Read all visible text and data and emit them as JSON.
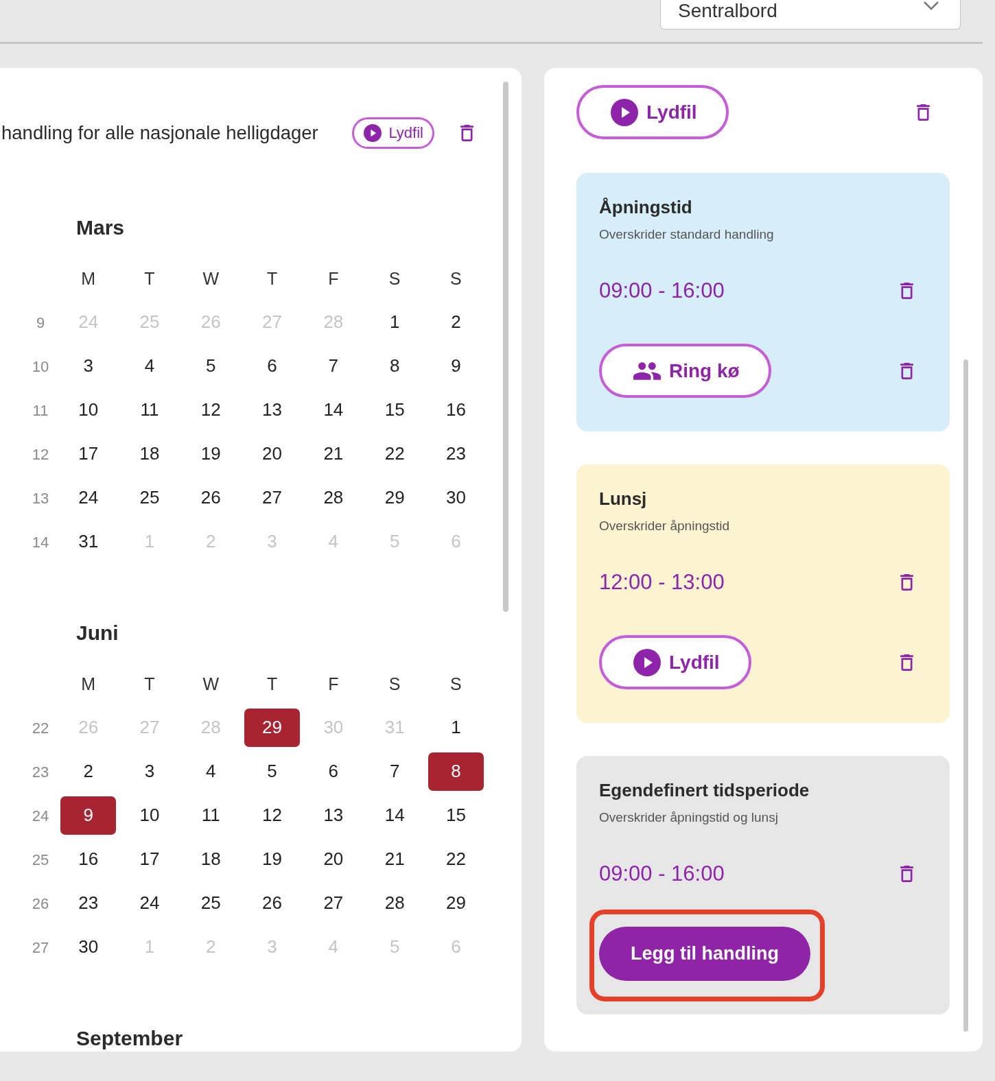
{
  "header": {
    "dropdown": {
      "value": "Sentralbord"
    }
  },
  "calendar_panel": {
    "title": "handling for alle nasjonale helligdager",
    "action": {
      "kind": "audio",
      "label": "Lydfil",
      "highlighted": false
    },
    "months": [
      {
        "name": "Mars",
        "weekday_labels": [
          "M",
          "T",
          "W",
          "T",
          "F",
          "S",
          "S"
        ],
        "weeks": [
          {
            "week": "9",
            "days": [
              {
                "day": "24",
                "kind": "outside"
              },
              {
                "day": "25",
                "kind": "outside"
              },
              {
                "day": "26",
                "kind": "outside"
              },
              {
                "day": "27",
                "kind": "outside"
              },
              {
                "day": "28",
                "kind": "outside"
              },
              {
                "day": "1",
                "kind": "current"
              },
              {
                "day": "2",
                "kind": "current"
              }
            ]
          },
          {
            "week": "10",
            "days": [
              {
                "day": "3",
                "kind": "current"
              },
              {
                "day": "4",
                "kind": "current"
              },
              {
                "day": "5",
                "kind": "current"
              },
              {
                "day": "6",
                "kind": "current"
              },
              {
                "day": "7",
                "kind": "current"
              },
              {
                "day": "8",
                "kind": "current"
              },
              {
                "day": "9",
                "kind": "current"
              }
            ]
          },
          {
            "week": "11",
            "days": [
              {
                "day": "10",
                "kind": "current"
              },
              {
                "day": "11",
                "kind": "current"
              },
              {
                "day": "12",
                "kind": "current"
              },
              {
                "day": "13",
                "kind": "current"
              },
              {
                "day": "14",
                "kind": "current"
              },
              {
                "day": "15",
                "kind": "current"
              },
              {
                "day": "16",
                "kind": "current"
              }
            ]
          },
          {
            "week": "12",
            "days": [
              {
                "day": "17",
                "kind": "current"
              },
              {
                "day": "18",
                "kind": "current"
              },
              {
                "day": "19",
                "kind": "current"
              },
              {
                "day": "20",
                "kind": "current"
              },
              {
                "day": "21",
                "kind": "current"
              },
              {
                "day": "22",
                "kind": "current"
              },
              {
                "day": "23",
                "kind": "current"
              }
            ]
          },
          {
            "week": "13",
            "days": [
              {
                "day": "24",
                "kind": "current"
              },
              {
                "day": "25",
                "kind": "current"
              },
              {
                "day": "26",
                "kind": "current"
              },
              {
                "day": "27",
                "kind": "current"
              },
              {
                "day": "28",
                "kind": "current"
              },
              {
                "day": "29",
                "kind": "current"
              },
              {
                "day": "30",
                "kind": "current"
              }
            ]
          },
          {
            "week": "14",
            "days": [
              {
                "day": "31",
                "kind": "current"
              },
              {
                "day": "1",
                "kind": "outside"
              },
              {
                "day": "2",
                "kind": "outside"
              },
              {
                "day": "3",
                "kind": "outside"
              },
              {
                "day": "4",
                "kind": "outside"
              },
              {
                "day": "5",
                "kind": "outside"
              },
              {
                "day": "6",
                "kind": "outside"
              }
            ]
          }
        ]
      },
      {
        "name": "Juni",
        "weekday_labels": [
          "M",
          "T",
          "W",
          "T",
          "F",
          "S",
          "S"
        ],
        "weeks": [
          {
            "week": "22",
            "days": [
              {
                "day": "26",
                "kind": "outside"
              },
              {
                "day": "27",
                "kind": "outside"
              },
              {
                "day": "28",
                "kind": "outside"
              },
              {
                "day": "29",
                "kind": "holiday"
              },
              {
                "day": "30",
                "kind": "outside"
              },
              {
                "day": "31",
                "kind": "outside"
              },
              {
                "day": "1",
                "kind": "current"
              }
            ]
          },
          {
            "week": "23",
            "days": [
              {
                "day": "2",
                "kind": "current"
              },
              {
                "day": "3",
                "kind": "current"
              },
              {
                "day": "4",
                "kind": "current"
              },
              {
                "day": "5",
                "kind": "current"
              },
              {
                "day": "6",
                "kind": "current"
              },
              {
                "day": "7",
                "kind": "current"
              },
              {
                "day": "8",
                "kind": "holiday"
              }
            ]
          },
          {
            "week": "24",
            "days": [
              {
                "day": "9",
                "kind": "holiday"
              },
              {
                "day": "10",
                "kind": "current"
              },
              {
                "day": "11",
                "kind": "current"
              },
              {
                "day": "12",
                "kind": "current"
              },
              {
                "day": "13",
                "kind": "current"
              },
              {
                "day": "14",
                "kind": "current"
              },
              {
                "day": "15",
                "kind": "current"
              }
            ]
          },
          {
            "week": "25",
            "days": [
              {
                "day": "16",
                "kind": "current"
              },
              {
                "day": "17",
                "kind": "current"
              },
              {
                "day": "18",
                "kind": "current"
              },
              {
                "day": "19",
                "kind": "current"
              },
              {
                "day": "20",
                "kind": "current"
              },
              {
                "day": "21",
                "kind": "current"
              },
              {
                "day": "22",
                "kind": "current"
              }
            ]
          },
          {
            "week": "26",
            "days": [
              {
                "day": "23",
                "kind": "current"
              },
              {
                "day": "24",
                "kind": "current"
              },
              {
                "day": "25",
                "kind": "current"
              },
              {
                "day": "26",
                "kind": "current"
              },
              {
                "day": "27",
                "kind": "current"
              },
              {
                "day": "28",
                "kind": "current"
              },
              {
                "day": "29",
                "kind": "current"
              }
            ]
          },
          {
            "week": "27",
            "days": [
              {
                "day": "30",
                "kind": "current"
              },
              {
                "day": "1",
                "kind": "outside"
              },
              {
                "day": "2",
                "kind": "outside"
              },
              {
                "day": "3",
                "kind": "outside"
              },
              {
                "day": "4",
                "kind": "outside"
              },
              {
                "day": "5",
                "kind": "outside"
              },
              {
                "day": "6",
                "kind": "outside"
              }
            ]
          }
        ]
      },
      {
        "name": "September"
      }
    ]
  },
  "rules_panel": {
    "default_action": {
      "kind": "audio",
      "label": "Lydfil",
      "highlighted": false
    },
    "periods": [
      {
        "title": "Åpningstid",
        "subtitle": "Overskrider standard handling",
        "color": "#d6eef9",
        "time": "09:00 - 16:00",
        "action": {
          "kind": "queue",
          "label": "Ring kø",
          "highlighted": false
        }
      },
      {
        "title": "Lunsj",
        "subtitle": "Overskrider åpningstid",
        "color": "#fcf3d0",
        "time": "12:00 - 13:00",
        "action": {
          "kind": "audio",
          "label": "Lydfil",
          "highlighted": false
        }
      },
      {
        "title": "Egendefinert tidsperiode",
        "subtitle": "Overskrider åpningstid og lunsj",
        "color": "#e6e6e6",
        "time": "09:00 - 16:00",
        "action": {
          "kind": "add",
          "label": "Legg til handling",
          "highlighted": true
        }
      }
    ]
  }
}
